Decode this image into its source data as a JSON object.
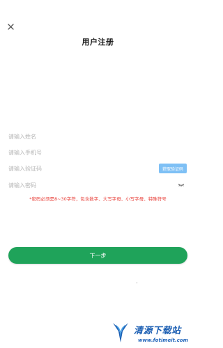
{
  "header": {
    "title": "用户注册",
    "close_icon": "close-icon"
  },
  "form": {
    "name_placeholder": "请输入姓名",
    "phone_placeholder": "请输入手机号",
    "code_placeholder": "请输入验证码",
    "code_button_label": "获取验证码",
    "password_placeholder": "请输入密码",
    "password_toggle_icon": "eye-closed-icon",
    "password_hint": "*密码必须是8~30字符，包含数字、大写字母、小写字母、特殊符号"
  },
  "actions": {
    "next_label": "下一步"
  },
  "watermark": {
    "title": "清源下载站",
    "url": "www.fotimeit.com"
  },
  "colors": {
    "primary_green": "#1fa35a",
    "code_button_blue": "#7ec0f5",
    "hint_red": "#e8403a",
    "watermark_blue": "#1c5fb3"
  }
}
